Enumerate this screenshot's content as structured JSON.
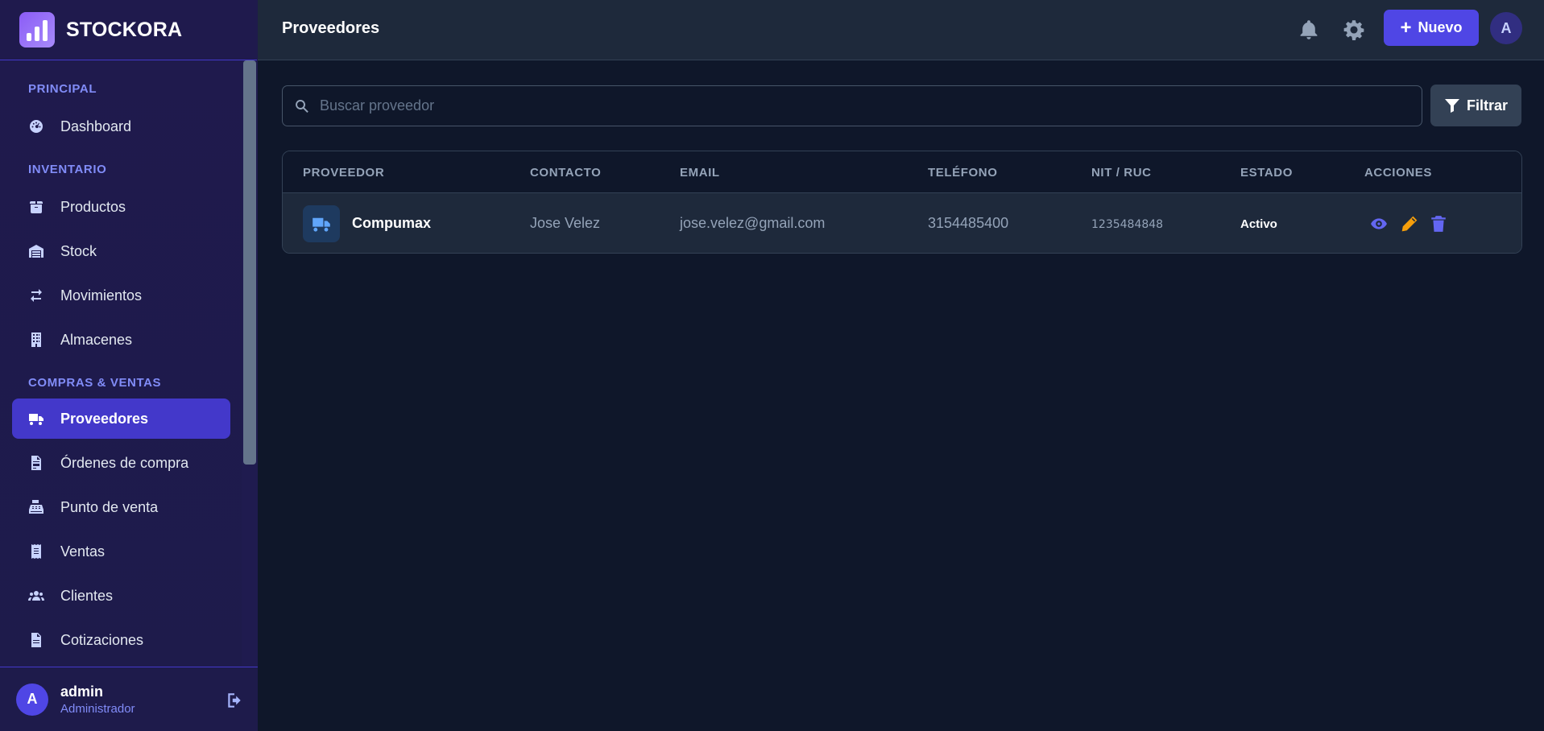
{
  "app": {
    "name": "STOCKORA"
  },
  "sidebar": {
    "sections": [
      {
        "label": "PRINCIPAL"
      },
      {
        "label": "INVENTARIO"
      },
      {
        "label": "COMPRAS & VENTAS"
      }
    ],
    "items": [
      {
        "label": "Dashboard",
        "icon": "gauge-icon"
      },
      {
        "label": "Productos",
        "icon": "box-icon"
      },
      {
        "label": "Stock",
        "icon": "warehouse-icon"
      },
      {
        "label": "Movimientos",
        "icon": "arrows-exchange-icon"
      },
      {
        "label": "Almacenes",
        "icon": "building-icon"
      },
      {
        "label": "Proveedores",
        "icon": "truck-icon",
        "active": true
      },
      {
        "label": "Órdenes de compra",
        "icon": "file-invoice-icon"
      },
      {
        "label": "Punto de venta",
        "icon": "cash-register-icon"
      },
      {
        "label": "Ventas",
        "icon": "receipt-icon"
      },
      {
        "label": "Clientes",
        "icon": "users-icon"
      },
      {
        "label": "Cotizaciones",
        "icon": "file-icon"
      }
    ],
    "user": {
      "initial": "A",
      "name": "admin",
      "role": "Administrador"
    }
  },
  "header": {
    "title": "Proveedores",
    "new_label": "Nuevo",
    "avatar_initial": "A"
  },
  "search": {
    "placeholder": "Buscar proveedor",
    "value": ""
  },
  "filter": {
    "label": "Filtrar"
  },
  "table": {
    "columns": [
      "PROVEEDOR",
      "CONTACTO",
      "EMAIL",
      "TELÉFONO",
      "NIT / RUC",
      "ESTADO",
      "ACCIONES"
    ],
    "rows": [
      {
        "proveedor": "Compumax",
        "contacto": "Jose Velez",
        "email": "jose.velez@gmail.com",
        "telefono": "3154485400",
        "nit": "1235484848",
        "estado": "Activo"
      }
    ]
  },
  "colors": {
    "accent": "#4f46e5",
    "view_action": "#6366f1",
    "edit_action": "#f59e0b",
    "delete_action": "#6366f1"
  }
}
